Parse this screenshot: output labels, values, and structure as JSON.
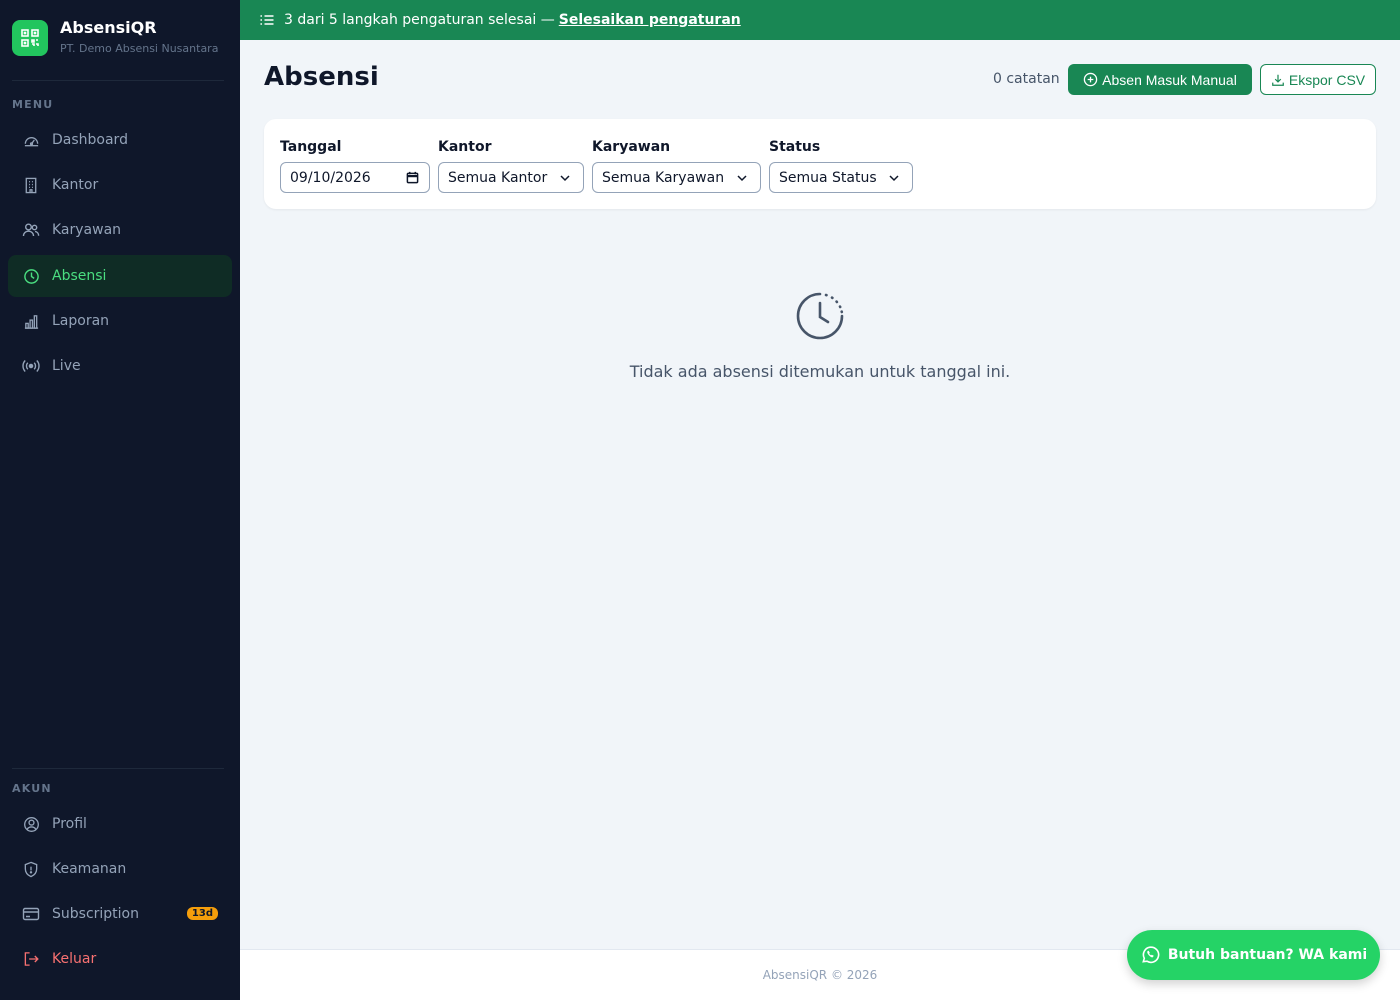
{
  "brand": {
    "name": "AbsensiQR",
    "org": "PT. Demo Absensi Nusantara"
  },
  "sidebar": {
    "menu_label": "MENU",
    "items": [
      {
        "label": "Dashboard",
        "icon": "gauge-icon"
      },
      {
        "label": "Kantor",
        "icon": "building-icon"
      },
      {
        "label": "Karyawan",
        "icon": "users-icon"
      },
      {
        "label": "Absensi",
        "icon": "clock-icon",
        "active": true
      },
      {
        "label": "Laporan",
        "icon": "bar-chart-icon"
      },
      {
        "label": "Live",
        "icon": "broadcast-icon"
      }
    ],
    "account_label": "AKUN",
    "account_items": [
      {
        "label": "Profil",
        "icon": "user-circle-icon"
      },
      {
        "label": "Keamanan",
        "icon": "shield-icon"
      },
      {
        "label": "Subscription",
        "icon": "credit-card-icon",
        "badge": "13d"
      },
      {
        "label": "Keluar",
        "icon": "logout-icon"
      }
    ]
  },
  "banner": {
    "text": "3 dari 5 langkah pengaturan selesai —",
    "link": "Selesaikan pengaturan"
  },
  "header": {
    "title": "Absensi",
    "count": "0 catatan",
    "manual_button": "Absen Masuk Manual",
    "export_button": "Ekspor CSV"
  },
  "filters": {
    "date_label": "Tanggal",
    "date_value": "09/10/2026",
    "office_label": "Kantor",
    "office_value": "Semua Kantor",
    "employee_label": "Karyawan",
    "employee_value": "Semua Karyawan",
    "status_label": "Status",
    "status_value": "Semua Status"
  },
  "empty_state": {
    "message": "Tidak ada absensi ditemukan untuk tanggal ini."
  },
  "footer": {
    "text": "AbsensiQR © 2026"
  },
  "help_button": {
    "label": "Butuh bantuan? WA kami"
  },
  "colors": {
    "accent": "#198754",
    "sidebar_bg": "#0f172a",
    "active_text": "#4ade80",
    "badge": "#f59e0b",
    "whatsapp": "#25d366",
    "danger": "#f87171"
  }
}
